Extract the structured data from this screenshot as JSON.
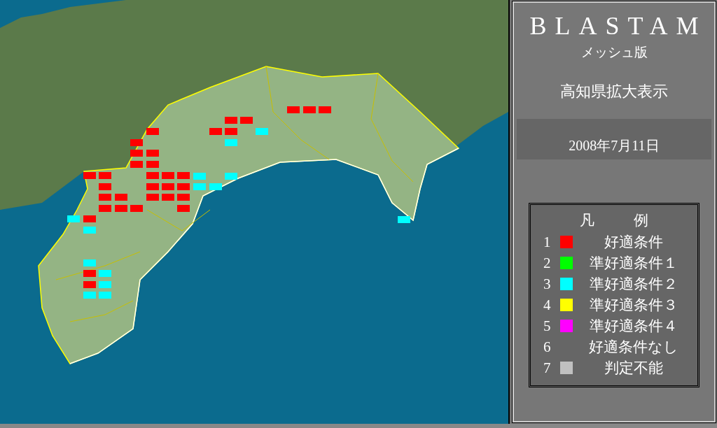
{
  "title": "BLASTAM",
  "subtitle": "メッシュ版",
  "region": "高知県拡大表示",
  "date": "2008年7月11日",
  "legend": {
    "title_left": "凡",
    "title_right": "例",
    "items": [
      {
        "number": "1",
        "color": "#ff0000",
        "label": "好適条件"
      },
      {
        "number": "2",
        "color": "#00ff00",
        "label": "準好適条件１"
      },
      {
        "number": "3",
        "color": "#00ffff",
        "label": "準好適条件２"
      },
      {
        "number": "4",
        "color": "#ffff00",
        "label": "準好適条件３"
      },
      {
        "number": "5",
        "color": "#ff00ff",
        "label": "準好適条件４"
      },
      {
        "number": "6",
        "label": "好適条件なし"
      },
      {
        "number": "7",
        "color": "#c0c0c0",
        "label": "判定不能"
      }
    ]
  }
}
